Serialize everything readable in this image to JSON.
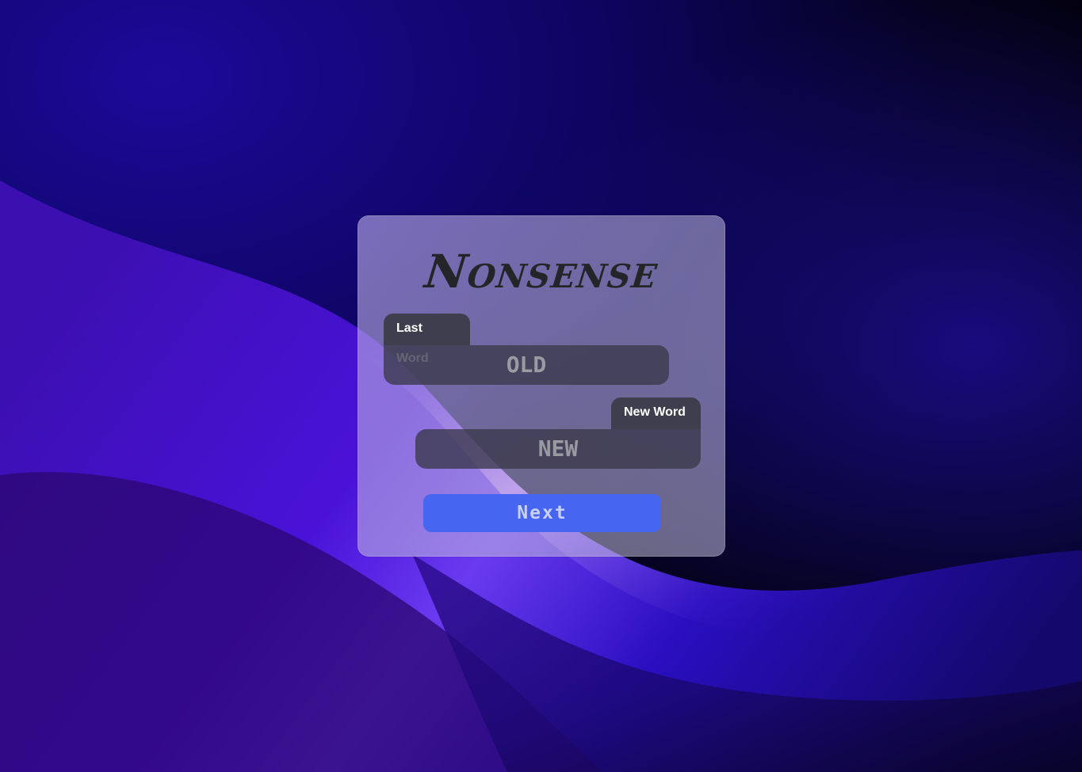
{
  "app": {
    "title": "Nonsense"
  },
  "last_word": {
    "label": "Last Word",
    "value": "OLD"
  },
  "new_word": {
    "label": "New Word",
    "value": "NEW"
  },
  "actions": {
    "next_label": "Next"
  },
  "colors": {
    "accent_button": "#4665f0",
    "tag_background": "#3f3e4e",
    "field_background": "#3a384a",
    "title_text": "#232528"
  }
}
